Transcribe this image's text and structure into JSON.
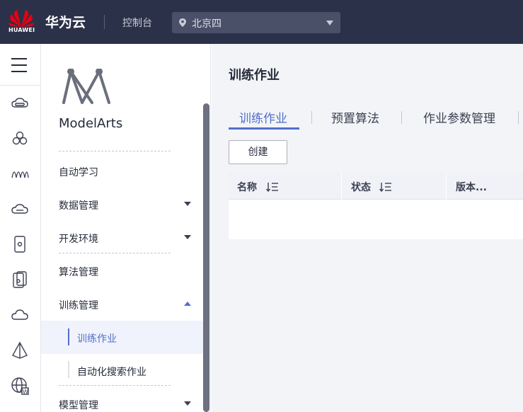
{
  "topbar": {
    "brand": "华为云",
    "logo_text": "HUAWEI",
    "console": "控制台",
    "region": "北京四"
  },
  "rail": {
    "icons": [
      "menu-icon",
      "cloud-server-icon",
      "hexagon-icon",
      "signal-icon",
      "storage-icon",
      "phone-icon",
      "tablet-icon",
      "cloud-icon",
      "pyramid-icon",
      "globe-icon"
    ]
  },
  "sidebar": {
    "product": "ModelArts",
    "items": [
      {
        "label": "自动学习"
      },
      {
        "label": "数据管理"
      },
      {
        "label": "开发环境"
      },
      {
        "label": "算法管理"
      },
      {
        "label": "训练管理"
      },
      {
        "label": "模型管理"
      }
    ],
    "sub_items": [
      {
        "label": "训练作业"
      },
      {
        "label": "自动化搜索作业"
      }
    ]
  },
  "main": {
    "title": "训练作业",
    "tabs": [
      {
        "label": "训练作业"
      },
      {
        "label": "预置算法"
      },
      {
        "label": "作业参数管理"
      }
    ],
    "create_button": "创建",
    "columns": [
      {
        "label": "名称"
      },
      {
        "label": "状态"
      },
      {
        "label": "版本..."
      }
    ]
  },
  "colors": {
    "topbar_bg": "#2b3148",
    "accent": "#526ecc",
    "huawei_red": "#e60012"
  }
}
